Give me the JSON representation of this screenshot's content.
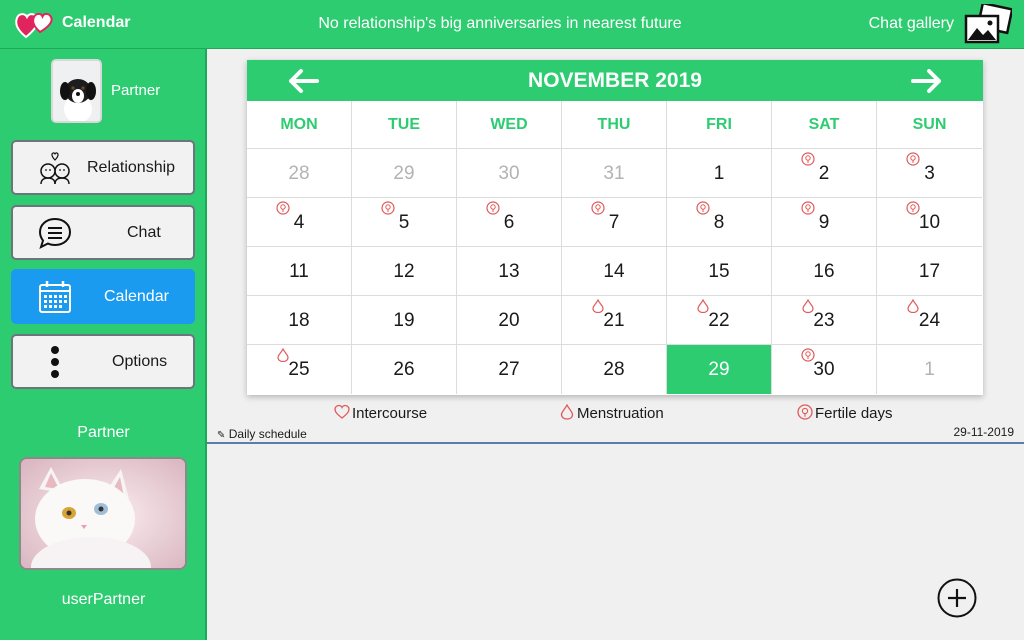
{
  "header": {
    "app_title": "Calendar",
    "message": "No relationship's big anniversaries in nearest future",
    "gallery_label": "Chat gallery",
    "logo_icon": "hearts-icon",
    "gallery_icon": "gallery-icon"
  },
  "sidebar": {
    "partner_top_label": "Partner",
    "nav": [
      {
        "label": "Relationship",
        "icon": "couple-icon"
      },
      {
        "label": "Chat",
        "icon": "chat-bubble-icon"
      },
      {
        "label": "Calendar",
        "icon": "calendar-icon"
      },
      {
        "label": "Options",
        "icon": "more-vertical-icon"
      }
    ],
    "partner_section_label": "Partner",
    "username": "userPartner"
  },
  "calendar": {
    "month_title": "NOVEMBER 2019",
    "weekdays": [
      "MON",
      "TUE",
      "WED",
      "THU",
      "FRI",
      "SAT",
      "SUN"
    ],
    "days": [
      [
        "28",
        "29",
        "30",
        "31",
        "1",
        "2",
        "3"
      ],
      [
        "4",
        "5",
        "6",
        "7",
        "8",
        "9",
        "10"
      ],
      [
        "11",
        "12",
        "13",
        "14",
        "15",
        "16",
        "17"
      ],
      [
        "18",
        "19",
        "20",
        "21",
        "22",
        "23",
        "24"
      ],
      [
        "25",
        "26",
        "27",
        "28",
        "29",
        "30",
        "1"
      ]
    ],
    "today": "29"
  },
  "legend": {
    "intercourse": "Intercourse",
    "menstruation": "Menstruation",
    "fertile": "Fertile days"
  },
  "schedule": {
    "label": "Daily schedule",
    "date": "29-11-2019"
  },
  "colors": {
    "accent": "#2ecc71",
    "active_nav": "#1a9bf0",
    "marker": "#e05a5a"
  }
}
